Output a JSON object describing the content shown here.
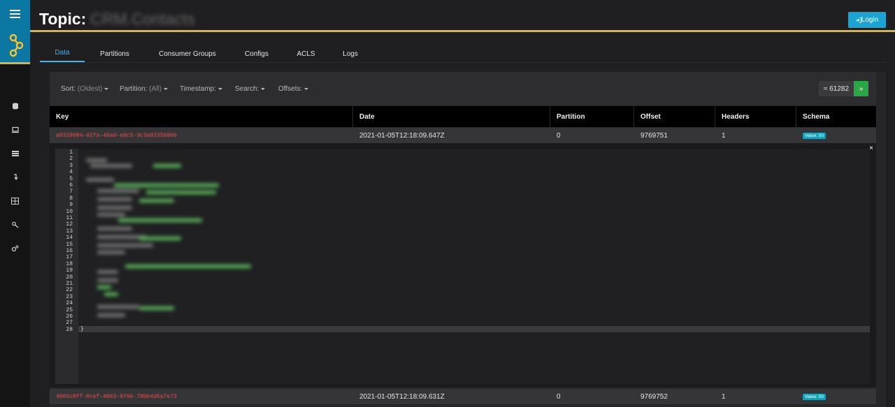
{
  "header": {
    "title_prefix": "Topic:",
    "title_value": "CRM.Contacts",
    "login_label": "Login"
  },
  "tabs": [
    {
      "label": "Data"
    },
    {
      "label": "Partitions"
    },
    {
      "label": "Consumer Groups"
    },
    {
      "label": "Configs"
    },
    {
      "label": "ACLS"
    },
    {
      "label": "Logs"
    }
  ],
  "filters": {
    "sort_label": "Sort:",
    "sort_value": "(Oldest)",
    "partition_label": "Partition:",
    "partition_value": "(All)",
    "timestamp_label": "Timestamp:",
    "search_label": "Search:",
    "offsets_label": "Offsets:",
    "count": "≈ 61282",
    "next_label": "»"
  },
  "table": {
    "columns": [
      "Key",
      "Date",
      "Partition",
      "Offset",
      "Headers",
      "Schema"
    ],
    "rows": [
      {
        "key": "a0328084-627a-49ad-a9c5-3c3a93356806",
        "date": "2021-01-05T12:18:09.647Z",
        "partition": "0",
        "offset": "9769751",
        "headers": "1",
        "schema": "Value: 50"
      },
      {
        "key": "4065c8ff-0cef-4863-9796-78bb4d5a7e73",
        "date": "2021-01-05T12:18:09.631Z",
        "partition": "0",
        "offset": "9769752",
        "headers": "1",
        "schema": "Value: 50"
      }
    ]
  },
  "expanded": {
    "close_label": "×",
    "line_numbers": [
      "1",
      "2",
      "3",
      "4",
      "5",
      "6",
      "7",
      "8",
      "9",
      "10",
      "11",
      "12",
      "13",
      "14",
      "15",
      "16",
      "17",
      "18",
      "19",
      "20",
      "21",
      "22",
      "23",
      "24",
      "25",
      "26",
      "27",
      "28"
    ],
    "closing_brace": "}"
  },
  "colors": {
    "accent": "#e0b330",
    "active_tab": "#3fb0e8",
    "login_button": "#1aa4d3",
    "next_button": "#28a745",
    "key_text": "#ff4d4d",
    "badge": "#17a2b8"
  },
  "icons": [
    "menu-icon",
    "app-logo-icon",
    "database-icon",
    "monitor-icon",
    "list-icon",
    "arrow-icon",
    "grid-icon",
    "key-icon",
    "settings-icon"
  ]
}
